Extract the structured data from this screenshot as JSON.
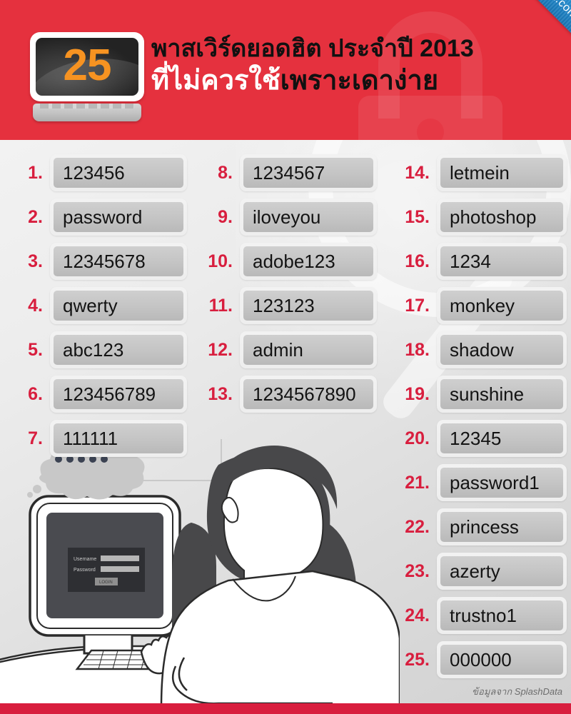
{
  "header": {
    "badge_number": "25",
    "title_line1": "พาสเวิร์ดยอดฮิต ประจำปี 2013",
    "title_line2_white": "ที่ไม่ควรใช้",
    "title_line2_black": "เพราะเดาง่าย",
    "ribbon_text": "www.kapook.com",
    "accent_red": "#e5313e",
    "badge_orange": "#f79321",
    "ribbon_blue": "#1f86c9"
  },
  "list": {
    "rank_color": "#d81e3e",
    "columns": [
      {
        "name": "column-1",
        "items": [
          {
            "rank": "1.",
            "password": "123456"
          },
          {
            "rank": "2.",
            "password": "password"
          },
          {
            "rank": "3.",
            "password": "12345678"
          },
          {
            "rank": "4.",
            "password": "qwerty"
          },
          {
            "rank": "5.",
            "password": "abc123"
          },
          {
            "rank": "6.",
            "password": "123456789"
          },
          {
            "rank": "7.",
            "password": "111111"
          }
        ]
      },
      {
        "name": "column-2",
        "items": [
          {
            "rank": "8.",
            "password": "1234567"
          },
          {
            "rank": "9.",
            "password": "iloveyou"
          },
          {
            "rank": "10.",
            "password": "adobe123"
          },
          {
            "rank": "11.",
            "password": "123123"
          },
          {
            "rank": "12.",
            "password": "admin"
          },
          {
            "rank": "13.",
            "password": "1234567890"
          }
        ]
      },
      {
        "name": "column-3",
        "items": [
          {
            "rank": "14.",
            "password": "letmein"
          },
          {
            "rank": "15.",
            "password": "photoshop"
          },
          {
            "rank": "16.",
            "password": "1234"
          },
          {
            "rank": "17.",
            "password": "monkey"
          },
          {
            "rank": "18.",
            "password": "shadow"
          },
          {
            "rank": "19.",
            "password": "sunshine"
          },
          {
            "rank": "20.",
            "password": "12345"
          },
          {
            "rank": "21.",
            "password": "password1"
          },
          {
            "rank": "22.",
            "password": "princess"
          },
          {
            "rank": "23.",
            "password": "azerty"
          },
          {
            "rank": "24.",
            "password": "trustno1"
          },
          {
            "rank": "25.",
            "password": "000000"
          }
        ]
      }
    ]
  },
  "illustration": {
    "login_username_label": "Username",
    "login_password_label": "Password",
    "login_button_label": "LOGIN",
    "thought_dots": "•••••"
  },
  "footer": {
    "credit": "ข้อมูลจาก SplashData",
    "bar_color": "#d81e3e"
  }
}
